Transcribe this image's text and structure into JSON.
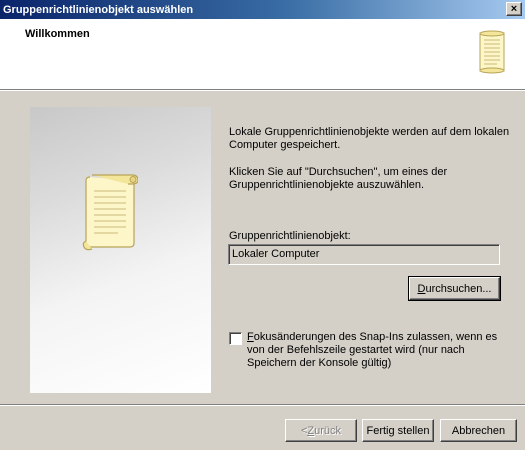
{
  "window": {
    "title": "Gruppenrichtlinienobjekt auswählen",
    "close_glyph": "×"
  },
  "header": {
    "title": "Willkommen",
    "icon": "scroll-icon"
  },
  "body": {
    "side_icon": "scroll-icon",
    "text1": "Lokale Gruppenrichtlinienobjekte werden auf dem lokalen Computer gespeichert.",
    "text2": "Klicken Sie auf \"Durchsuchen\", um eines der Gruppenrichtlinienobjekte auszuwählen.",
    "field_label": "Gruppenrichtlinienobjekt:",
    "field_value": "Lokaler Computer",
    "browse": {
      "accel": "D",
      "rest": "urchsuchen..."
    },
    "checkbox": {
      "checked": false,
      "accel": "F",
      "rest": "okusänderungen des Snap-Ins zulassen, wenn es von der Befehlszeile gestartet wird (nur nach Speichern der Konsole gültig)"
    }
  },
  "footer": {
    "back": {
      "prefix": "< ",
      "accel": "Z",
      "rest": "urück",
      "enabled": false
    },
    "finish": "Fertig stellen",
    "cancel": "Abbrechen"
  },
  "colors": {
    "titlebar_start": "#0a246a",
    "titlebar_end": "#a6caf0",
    "dialog_face": "#d4d0c8",
    "scroll_paper": "#fdf6c8"
  }
}
